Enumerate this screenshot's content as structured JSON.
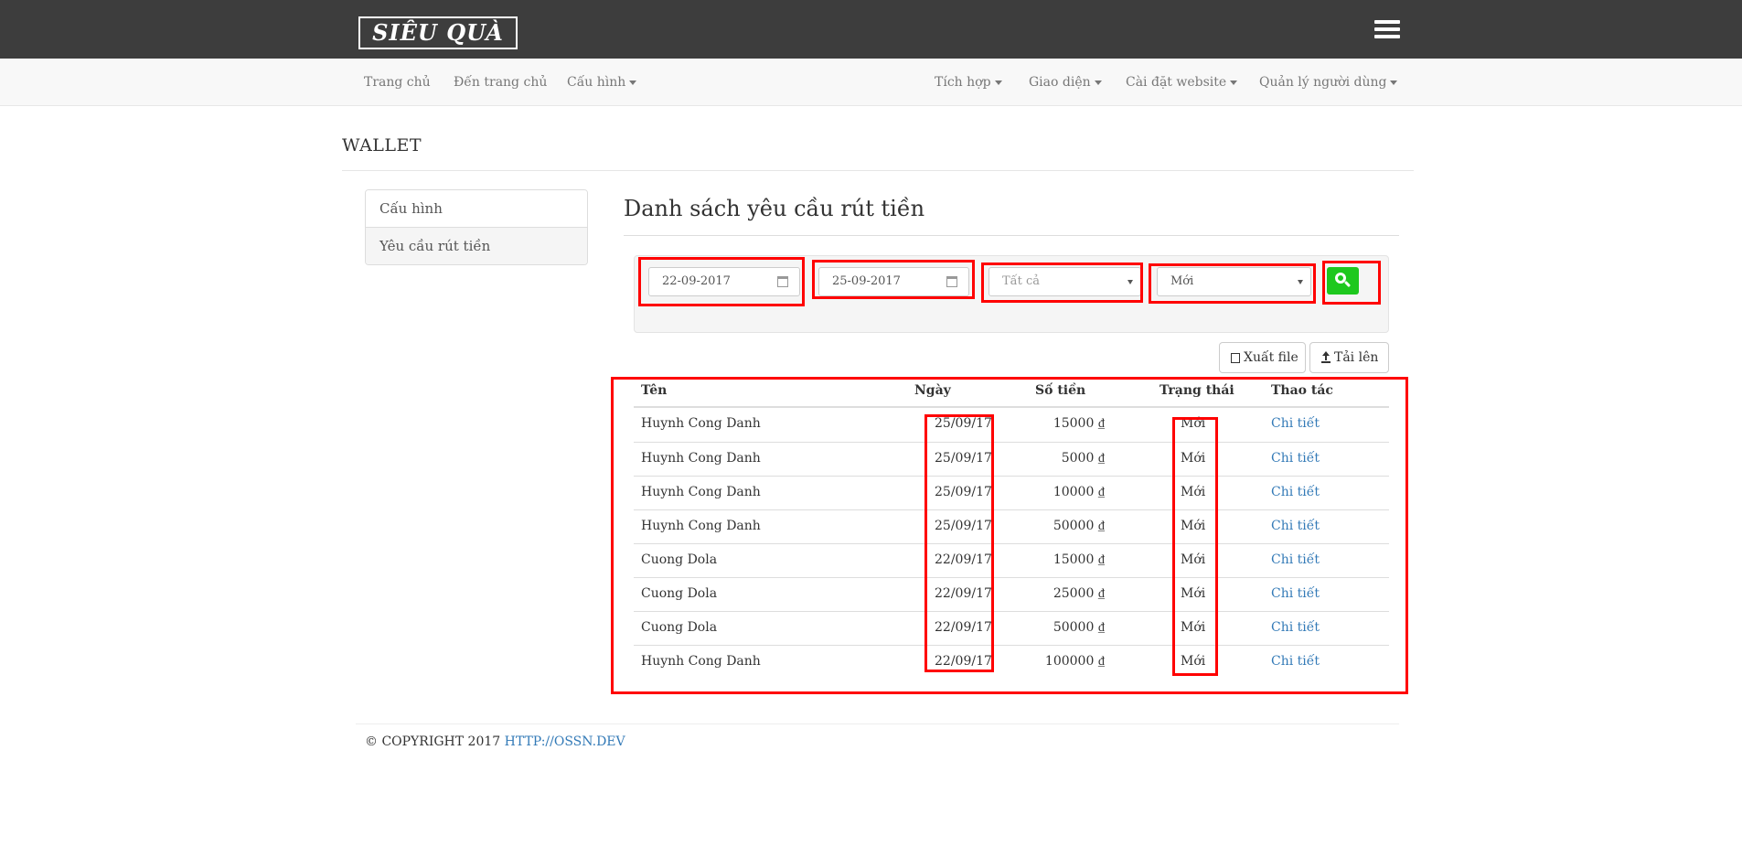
{
  "header": {
    "logo": "SIÊU QUÀ",
    "menu_icon": "hamburger-menu-icon"
  },
  "nav": {
    "left": [
      {
        "label": "Trang chủ",
        "dropdown": false
      },
      {
        "label": "Đến trang chủ",
        "dropdown": false
      },
      {
        "label": "Cấu hình",
        "dropdown": true
      }
    ],
    "right": [
      {
        "label": "Tích hợp",
        "dropdown": true
      },
      {
        "label": "Giao diện",
        "dropdown": true
      },
      {
        "label": "Cài đặt website",
        "dropdown": true
      },
      {
        "label": "Quản lý người dùng",
        "dropdown": true
      }
    ]
  },
  "page": {
    "heading": "WALLET"
  },
  "sidebar": {
    "items": [
      {
        "label": "Cấu hình",
        "active": false
      },
      {
        "label": "Yêu cầu rút tiền",
        "active": true
      }
    ]
  },
  "main": {
    "title": "Danh sách yêu cầu rút tiền",
    "filters": {
      "date_from": "22-09-2017",
      "date_to": "25-09-2017",
      "type_select": "Tất cả",
      "status_select": "Mới",
      "search_icon": "search-icon"
    },
    "buttons": {
      "export": "Xuất file",
      "upload": "Tải lên"
    },
    "table": {
      "columns": [
        "Tên",
        "Ngày",
        "Số tiền",
        "Trạng thái",
        "Thao tác"
      ],
      "rows": [
        {
          "name": "Huynh Cong Danh",
          "date": "25/09/17",
          "amount": "15000 ₫",
          "status": "Mới",
          "action": "Chi tiết"
        },
        {
          "name": "Huynh Cong Danh",
          "date": "25/09/17",
          "amount": "5000 ₫",
          "status": "Mới",
          "action": "Chi tiết"
        },
        {
          "name": "Huynh Cong Danh",
          "date": "25/09/17",
          "amount": "10000 ₫",
          "status": "Mới",
          "action": "Chi tiết"
        },
        {
          "name": "Huynh Cong Danh",
          "date": "25/09/17",
          "amount": "50000 ₫",
          "status": "Mới",
          "action": "Chi tiết"
        },
        {
          "name": "Cuong Dola",
          "date": "22/09/17",
          "amount": "15000 ₫",
          "status": "Mới",
          "action": "Chi tiết"
        },
        {
          "name": "Cuong Dola",
          "date": "22/09/17",
          "amount": "25000 ₫",
          "status": "Mới",
          "action": "Chi tiết"
        },
        {
          "name": "Cuong Dola",
          "date": "22/09/17",
          "amount": "50000 ₫",
          "status": "Mới",
          "action": "Chi tiết"
        },
        {
          "name": "Huynh Cong Danh",
          "date": "22/09/17",
          "amount": "100000 ₫",
          "status": "Mới",
          "action": "Chi tiết"
        }
      ]
    }
  },
  "footer": {
    "copyright": "© COPYRIGHT 2017",
    "link": "HTTP://OSSN.DEV"
  },
  "colors": {
    "topbar": "#3d3d3d",
    "highlight": "#ff0000",
    "search_button": "#1ec81e",
    "link": "#337ab7"
  }
}
